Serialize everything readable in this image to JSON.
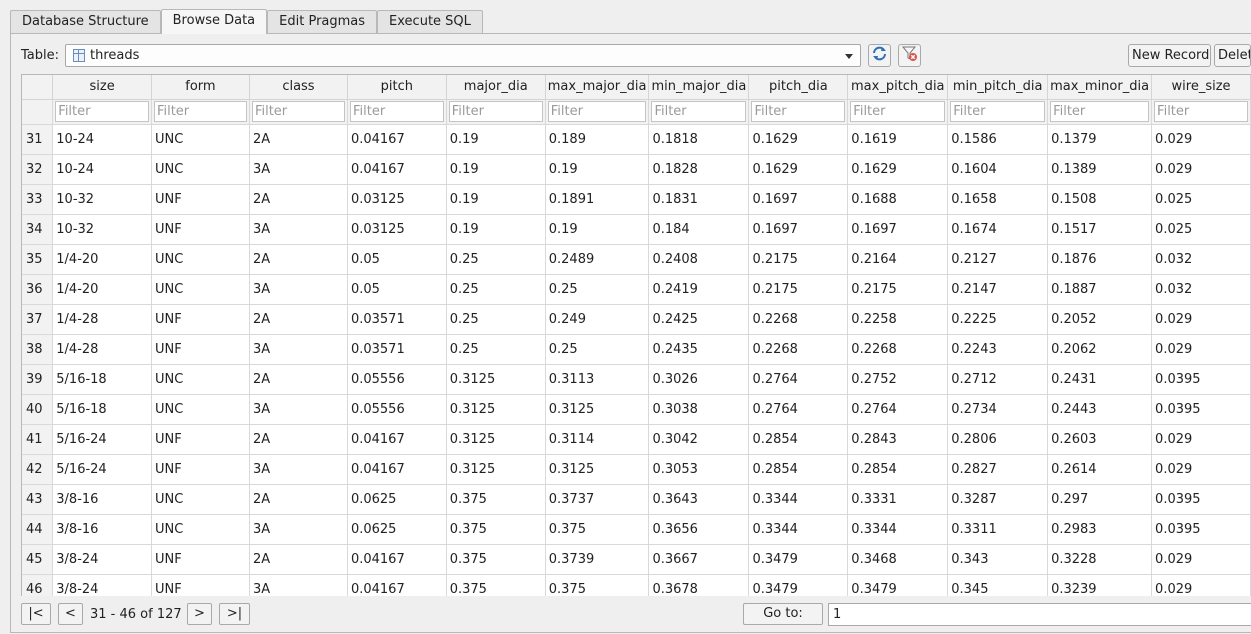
{
  "tabs": [
    {
      "label": "Database Structure",
      "active": false
    },
    {
      "label": "Browse Data",
      "active": true
    },
    {
      "label": "Edit Pragmas",
      "active": false
    },
    {
      "label": "Execute SQL",
      "active": false
    }
  ],
  "toolbar": {
    "table_label": "Table:",
    "table_name": "threads",
    "new_record_label": "New Record",
    "delete_record_label": "Delete Record"
  },
  "grid": {
    "columns": [
      "size",
      "form",
      "class",
      "pitch",
      "major_dia",
      "max_major_dia",
      "min_major_dia",
      "pitch_dia",
      "max_pitch_dia",
      "min_pitch_dia",
      "max_minor_dia",
      "wire_size"
    ],
    "filter_placeholder": "Filter",
    "rows": [
      {
        "id": "31",
        "cells": [
          "10-24",
          "UNC",
          "2A",
          "0.04167",
          "0.19",
          "0.189",
          "0.1818",
          "0.1629",
          "0.1619",
          "0.1586",
          "0.1379",
          "0.029"
        ]
      },
      {
        "id": "32",
        "cells": [
          "10-24",
          "UNC",
          "3A",
          "0.04167",
          "0.19",
          "0.19",
          "0.1828",
          "0.1629",
          "0.1629",
          "0.1604",
          "0.1389",
          "0.029"
        ]
      },
      {
        "id": "33",
        "cells": [
          "10-32",
          "UNF",
          "2A",
          "0.03125",
          "0.19",
          "0.1891",
          "0.1831",
          "0.1697",
          "0.1688",
          "0.1658",
          "0.1508",
          "0.025"
        ]
      },
      {
        "id": "34",
        "cells": [
          "10-32",
          "UNF",
          "3A",
          "0.03125",
          "0.19",
          "0.19",
          "0.184",
          "0.1697",
          "0.1697",
          "0.1674",
          "0.1517",
          "0.025"
        ]
      },
      {
        "id": "35",
        "cells": [
          "1/4-20",
          "UNC",
          "2A",
          "0.05",
          "0.25",
          "0.2489",
          "0.2408",
          "0.2175",
          "0.2164",
          "0.2127",
          "0.1876",
          "0.032"
        ]
      },
      {
        "id": "36",
        "cells": [
          "1/4-20",
          "UNC",
          "3A",
          "0.05",
          "0.25",
          "0.25",
          "0.2419",
          "0.2175",
          "0.2175",
          "0.2147",
          "0.1887",
          "0.032"
        ]
      },
      {
        "id": "37",
        "cells": [
          "1/4-28",
          "UNF",
          "2A",
          "0.03571",
          "0.25",
          "0.249",
          "0.2425",
          "0.2268",
          "0.2258",
          "0.2225",
          "0.2052",
          "0.029"
        ]
      },
      {
        "id": "38",
        "cells": [
          "1/4-28",
          "UNF",
          "3A",
          "0.03571",
          "0.25",
          "0.25",
          "0.2435",
          "0.2268",
          "0.2268",
          "0.2243",
          "0.2062",
          "0.029"
        ]
      },
      {
        "id": "39",
        "cells": [
          "5/16-18",
          "UNC",
          "2A",
          "0.05556",
          "0.3125",
          "0.3113",
          "0.3026",
          "0.2764",
          "0.2752",
          "0.2712",
          "0.2431",
          "0.0395"
        ]
      },
      {
        "id": "40",
        "cells": [
          "5/16-18",
          "UNC",
          "3A",
          "0.05556",
          "0.3125",
          "0.3125",
          "0.3038",
          "0.2764",
          "0.2764",
          "0.2734",
          "0.2443",
          "0.0395"
        ]
      },
      {
        "id": "41",
        "cells": [
          "5/16-24",
          "UNF",
          "2A",
          "0.04167",
          "0.3125",
          "0.3114",
          "0.3042",
          "0.2854",
          "0.2843",
          "0.2806",
          "0.2603",
          "0.029"
        ]
      },
      {
        "id": "42",
        "cells": [
          "5/16-24",
          "UNF",
          "3A",
          "0.04167",
          "0.3125",
          "0.3125",
          "0.3053",
          "0.2854",
          "0.2854",
          "0.2827",
          "0.2614",
          "0.029"
        ]
      },
      {
        "id": "43",
        "cells": [
          "3/8-16",
          "UNC",
          "2A",
          "0.0625",
          "0.375",
          "0.3737",
          "0.3643",
          "0.3344",
          "0.3331",
          "0.3287",
          "0.297",
          "0.0395"
        ]
      },
      {
        "id": "44",
        "cells": [
          "3/8-16",
          "UNC",
          "3A",
          "0.0625",
          "0.375",
          "0.375",
          "0.3656",
          "0.3344",
          "0.3344",
          "0.3311",
          "0.2983",
          "0.0395"
        ]
      },
      {
        "id": "45",
        "cells": [
          "3/8-24",
          "UNF",
          "2A",
          "0.04167",
          "0.375",
          "0.3739",
          "0.3667",
          "0.3479",
          "0.3468",
          "0.343",
          "0.3228",
          "0.029"
        ]
      },
      {
        "id": "46",
        "cells": [
          "3/8-24",
          "UNF",
          "3A",
          "0.04167",
          "0.375",
          "0.375",
          "0.3678",
          "0.3479",
          "0.3479",
          "0.345",
          "0.3239",
          "0.029"
        ]
      }
    ]
  },
  "navigation": {
    "first_label": "|<",
    "prev_label": "<",
    "page_info": "31 - 46 of 127",
    "next_label": ">",
    "last_label": ">|",
    "goto_label": "Go to:",
    "goto_value": "1"
  },
  "colors": {
    "refresh_icon": "#2a6fb8",
    "clear_filter_icon": "#d9534f"
  }
}
